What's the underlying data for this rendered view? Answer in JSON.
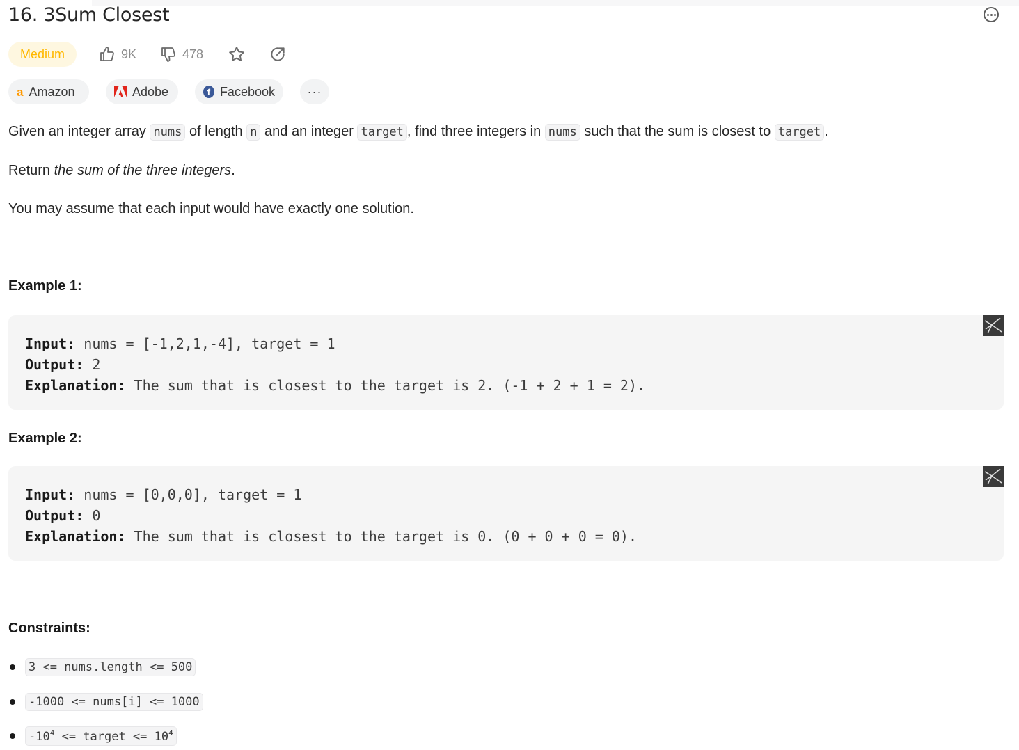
{
  "problem": {
    "title": "16. 3Sum Closest",
    "difficulty": "Medium",
    "likes": "9K",
    "dislikes": "478"
  },
  "companies": [
    {
      "name": "Amazon"
    },
    {
      "name": "Adobe"
    },
    {
      "name": "Facebook"
    }
  ],
  "description": {
    "p1": {
      "t1": "Given an integer array ",
      "c1": "nums",
      "t2": " of length ",
      "c2": "n",
      "t3": " and an integer ",
      "c3": "target",
      "t4": ", find three integers in ",
      "c4": "nums",
      "t5": " such that the sum is closest to ",
      "c5": "target",
      "t6": "."
    },
    "p2": {
      "t1": "Return ",
      "em": "the sum of the three integers",
      "t2": "."
    },
    "p3": "You may assume that each input would have exactly one solution."
  },
  "examples": [
    {
      "heading": "Example 1:",
      "input_label": "Input:",
      "input": " nums = [-1,2,1,-4], target = 1",
      "output_label": "Output:",
      "output": " 2",
      "explanation_label": "Explanation:",
      "explanation": " The sum that is closest to the target is 2. (-1 + 2 + 1 = 2)."
    },
    {
      "heading": "Example 2:",
      "input_label": "Input:",
      "input": " nums = [0,0,0], target = 1",
      "output_label": "Output:",
      "output": " 0",
      "explanation_label": "Explanation:",
      "explanation": " The sum that is closest to the target is 0. (0 + 0 + 0 = 0)."
    }
  ],
  "constraints": {
    "heading": "Constraints:",
    "c1": "3 <= nums.length <= 500",
    "c2": "-1000 <= nums[i] <= 1000",
    "c3": {
      "a": "-10",
      "sup1": "4",
      "b": " <= target <= 10",
      "sup2": "4"
    }
  },
  "colors": {
    "difficulty_text": "#ffb800",
    "difficulty_bg": "#fef7e0",
    "amazon": "#ff9900",
    "adobe": "#e1251b",
    "facebook": "#3b5998"
  },
  "icons": [
    "thumbs-up-icon",
    "thumbs-down-icon",
    "star-icon",
    "share-icon",
    "more-icon",
    "amazon-icon",
    "adobe-icon",
    "facebook-icon",
    "visualize-icon"
  ]
}
